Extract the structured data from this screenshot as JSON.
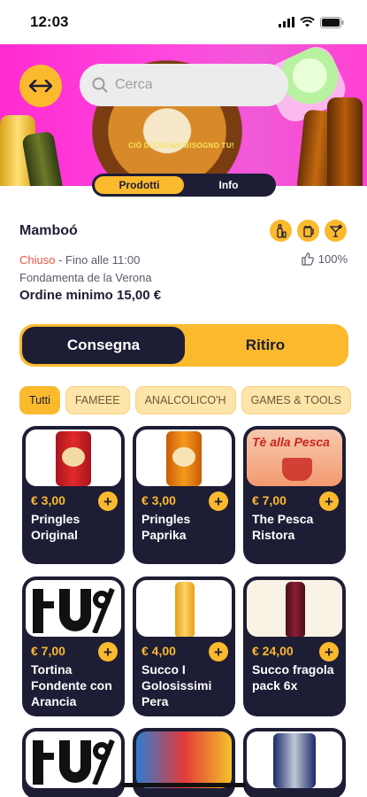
{
  "status_bar": {
    "time": "12:03"
  },
  "hero": {
    "tagline": "CIÒ DI CUI HAI BISOGNO TU!"
  },
  "search": {
    "placeholder": "Cerca"
  },
  "tabs": [
    {
      "label": "Prodotti",
      "active": true
    },
    {
      "label": "Info",
      "active": false
    }
  ],
  "shop": {
    "name": "Mamboó",
    "status_closed": "Chiuso",
    "status_rest": " - Fino alle 11:00",
    "rating": "100%",
    "address": "Fondamenta de la Verona",
    "min_order": "Ordine minimo 15,00 €",
    "category_icons": [
      "beer-bottle-icon",
      "beer-mug-icon",
      "cocktail-icon"
    ]
  },
  "delivery_toggle": {
    "active": "Consegna",
    "inactive": "Ritiro"
  },
  "categories": [
    "Tutti",
    "FAMEEE",
    "ANALCOLICO'H",
    "GAMES & TOOLS"
  ],
  "products": [
    {
      "price": "€ 3,00",
      "name": "Pringles Original"
    },
    {
      "price": "€ 3,00",
      "name": "Pringles Paprika"
    },
    {
      "price": "€ 7,00",
      "name": "The Pesca Ristora"
    },
    {
      "price": "€ 7,00",
      "name": "Tortina Fondente con Arancia"
    },
    {
      "price": "€ 4,00",
      "name": "Succo I Golosissimi Pera"
    },
    {
      "price": "€ 24,00",
      "name": "Succo fragola pack 6x"
    }
  ],
  "product_image_text": {
    "pesca": "Tè alla Pesca"
  },
  "colors": {
    "accent": "#fbb92e",
    "dark": "#1d1d35",
    "hero_pink": "#ff2ad1",
    "closed_red": "#e8553e"
  }
}
